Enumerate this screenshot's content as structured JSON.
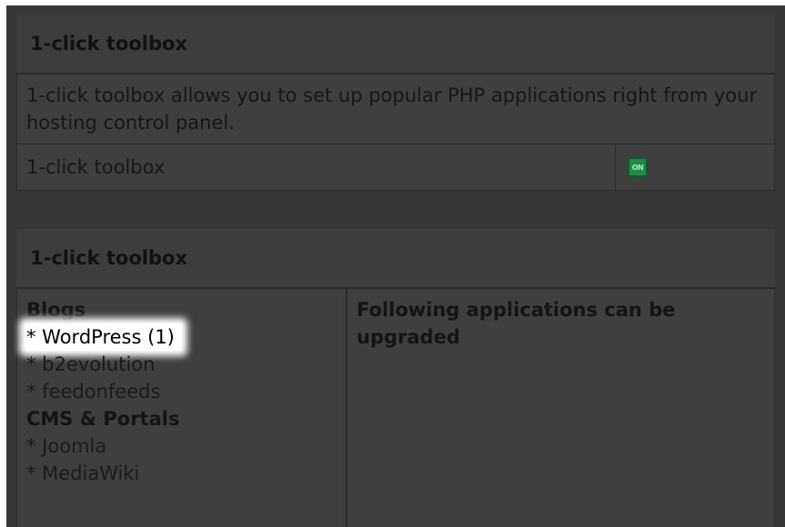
{
  "settings_panel": {
    "title": "1-click toolbox",
    "description": "1-click toolbox allows you to set up popular PHP applications right from your hosting control panel.",
    "row_label": "1-click toolbox",
    "toggle_label": "ON"
  },
  "apps_panel": {
    "title": "1-click toolbox",
    "categories": [
      {
        "name": "Blogs",
        "items": [
          "* WordPress (1)",
          "* b2evolution",
          "* feedonfeeds"
        ]
      },
      {
        "name": "CMS & Portals",
        "items": [
          "* Joomla",
          "* MediaWiki"
        ]
      }
    ],
    "upgrade_heading": "Following applications can be upgraded"
  }
}
